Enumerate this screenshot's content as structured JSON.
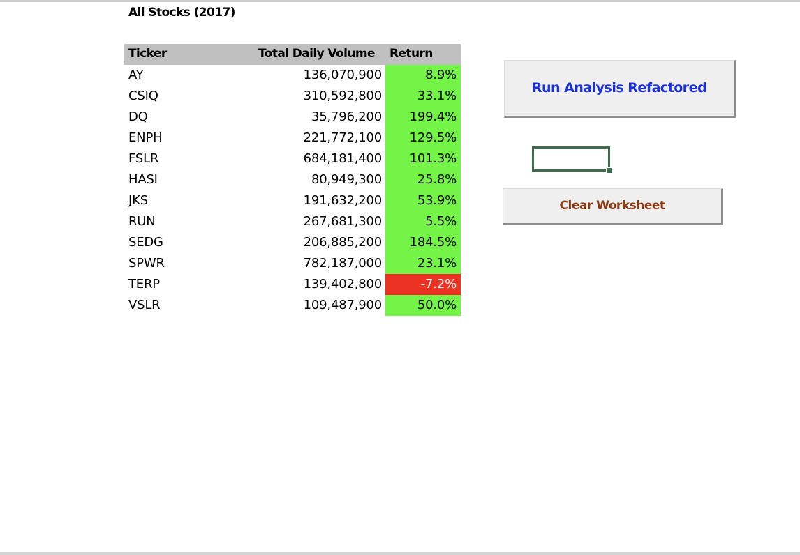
{
  "sheet": {
    "title": "All Stocks (2017)",
    "headers": {
      "ticker": "Ticker",
      "volume": "Total Daily Volume",
      "return": "Return"
    },
    "rows": [
      {
        "ticker": "AY",
        "volume": "136,070,900",
        "return": "8.9%",
        "status": "positive"
      },
      {
        "ticker": "CSIQ",
        "volume": "310,592,800",
        "return": "33.1%",
        "status": "positive"
      },
      {
        "ticker": "DQ",
        "volume": "35,796,200",
        "return": "199.4%",
        "status": "positive"
      },
      {
        "ticker": "ENPH",
        "volume": "221,772,100",
        "return": "129.5%",
        "status": "positive"
      },
      {
        "ticker": "FSLR",
        "volume": "684,181,400",
        "return": "101.3%",
        "status": "positive"
      },
      {
        "ticker": "HASI",
        "volume": "80,949,300",
        "return": "25.8%",
        "status": "positive"
      },
      {
        "ticker": "JKS",
        "volume": "191,632,200",
        "return": "53.9%",
        "status": "positive"
      },
      {
        "ticker": "RUN",
        "volume": "267,681,300",
        "return": "5.5%",
        "status": "positive"
      },
      {
        "ticker": "SEDG",
        "volume": "206,885,200",
        "return": "184.5%",
        "status": "positive"
      },
      {
        "ticker": "SPWR",
        "volume": "782,187,000",
        "return": "23.1%",
        "status": "positive"
      },
      {
        "ticker": "TERP",
        "volume": "139,402,800",
        "return": "-7.2%",
        "status": "negative"
      },
      {
        "ticker": "VSLR",
        "volume": "109,487,900",
        "return": "50.0%",
        "status": "positive"
      }
    ]
  },
  "buttons": {
    "run_label": "Run Analysis Refactored",
    "clear_label": "Clear Worksheet"
  },
  "colors": {
    "positive_fill": "#73f447",
    "negative_fill": "#ea3323",
    "header_fill": "#c0c0c0",
    "run_text": "#1a2fe0",
    "clear_text": "#8b3a13",
    "selection_border": "#3d6e4b"
  }
}
